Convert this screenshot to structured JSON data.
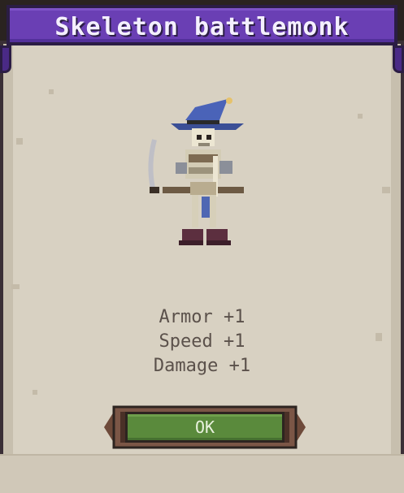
{
  "dialog": {
    "title": "Skeleton battlemonk",
    "character_icon": "skeleton-battlemonk-icon",
    "stats": [
      "Armor +1",
      "Speed +1",
      "Damage +1"
    ],
    "ok_label": "OK"
  },
  "colors": {
    "header": "#6a3fb4",
    "parchment": "#d8d1c2",
    "button": "#5a8a3c",
    "text": "#5b514b"
  }
}
